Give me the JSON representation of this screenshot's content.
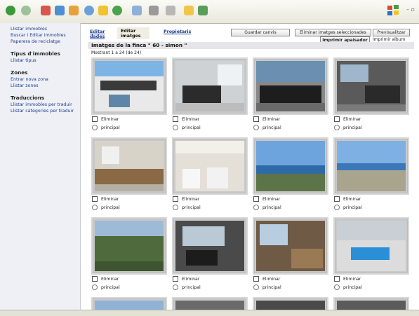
{
  "sidebar": {
    "top_items": [
      {
        "label": "Llistar immobles"
      },
      {
        "label": "Buscar i Editar immobles"
      },
      {
        "label": "Paperera de reciclatge"
      }
    ],
    "sections": [
      {
        "heading": "Tipus d'immobles",
        "items": [
          {
            "label": "Llistar tipus"
          }
        ]
      },
      {
        "heading": "Zones",
        "items": [
          {
            "label": "Entrar nova zona"
          },
          {
            "label": "Llistar zones"
          }
        ]
      },
      {
        "heading": "Traduccions",
        "items": [
          {
            "label": "Llistar immobles per traduir"
          },
          {
            "label": "Llistar categories per traduir"
          }
        ]
      }
    ]
  },
  "tabs": {
    "edit_data": "Editar dades",
    "edit_images": "Editar imatges",
    "owners": "Propietaris"
  },
  "buttons": {
    "save_changes": "Guardar canvis",
    "delete_selected": "Eliminar imatges seleccionades",
    "preview": "Previsualitzar",
    "print_saver": "Imprimir apaisador",
    "print_album": "Imprimir album"
  },
  "page": {
    "title": "Imatges de la finca \" 60 - simon \"",
    "count": "Mostrant 1 a 24 (de 24)"
  },
  "card_labels": {
    "delete": "Eliminar",
    "main": "principal"
  },
  "colors": {
    "link": "#1e3d8f",
    "sidebar_bg": "#eef0f5",
    "active_tab_bg": "#f0eee2"
  }
}
